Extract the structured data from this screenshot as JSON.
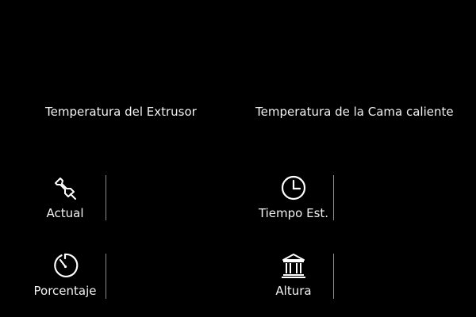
{
  "headings": {
    "extruder_temp": "Temperatura del Extrusor",
    "bed_temp": "Temperatura de la Cama caliente"
  },
  "stats": {
    "actual": {
      "label": "Actual",
      "icon": "pushpin-icon"
    },
    "time_estimate": {
      "label": "Tiempo Est.",
      "icon": "clock-icon"
    },
    "percentage": {
      "label": "Porcentaje",
      "icon": "stopwatch-dial-icon"
    },
    "height": {
      "label": "Altura",
      "icon": "building-columns-icon"
    }
  },
  "colors": {
    "background": "#000000",
    "text": "#f2f2f2",
    "divider": "#8a8a8a"
  }
}
